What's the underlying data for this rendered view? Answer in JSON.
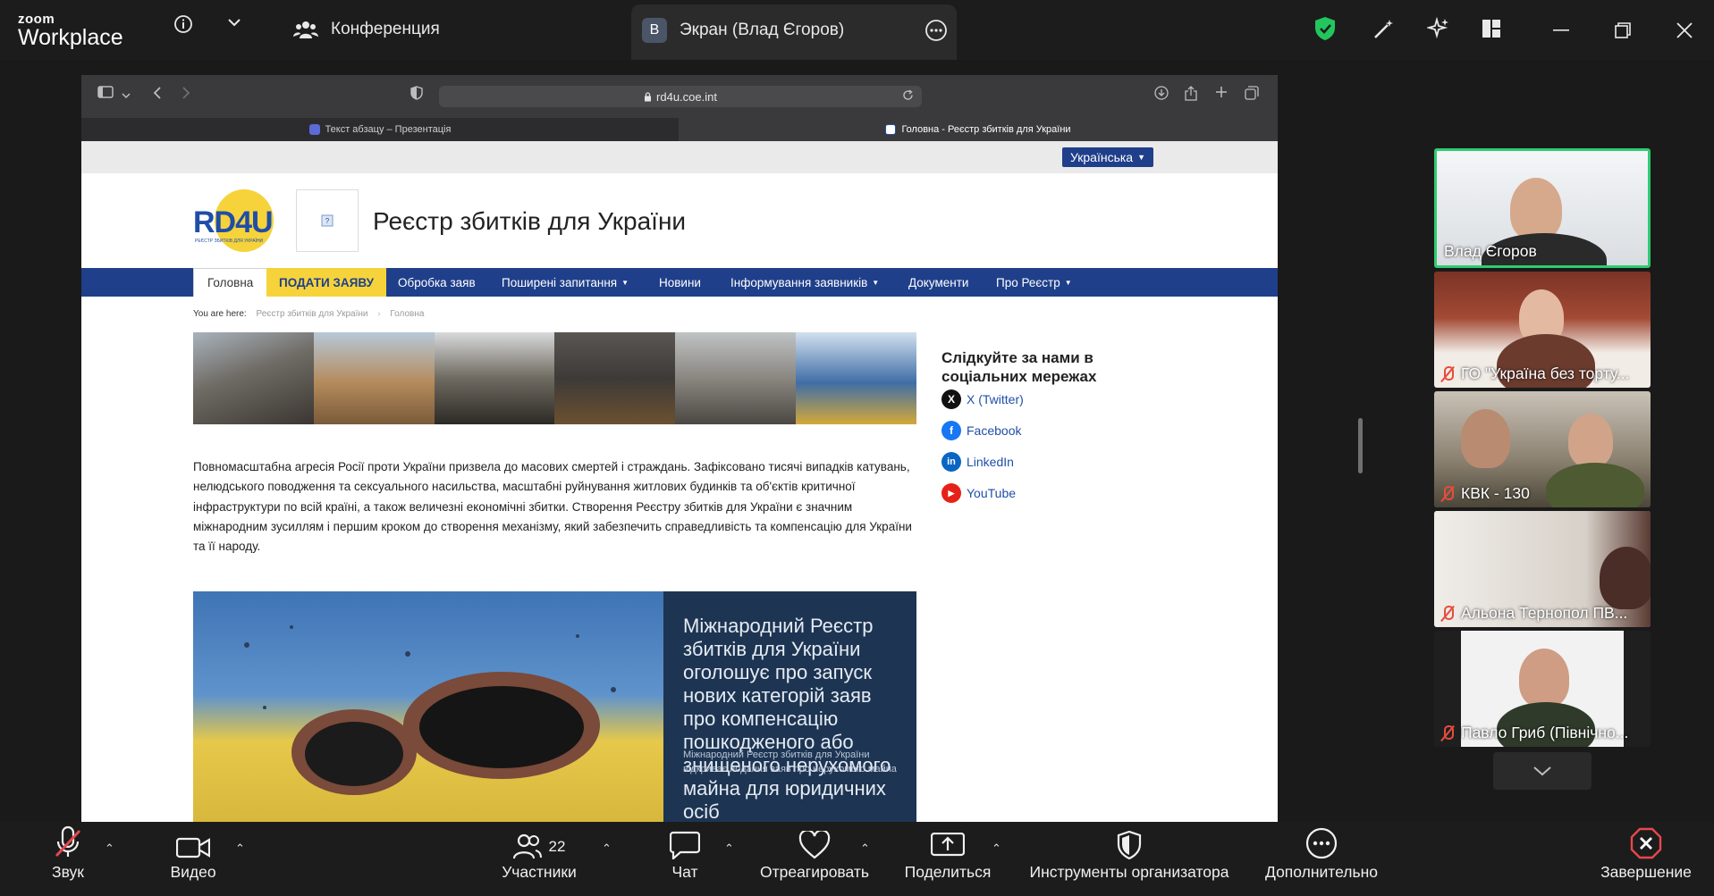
{
  "zoom": {
    "brand_small": "zoom",
    "brand_large": "Workplace",
    "conference_label": "Конференция",
    "screen_badge": "В",
    "screen_label": "Экран (Влад Єгоров)"
  },
  "browser": {
    "url": "rd4u.coe.int",
    "tabs": [
      {
        "title": "Текст абзацу – Презентація"
      },
      {
        "title": "Головна - Реєстр збитків для України"
      }
    ]
  },
  "site": {
    "language": "Українська",
    "logo_text": "RD4U",
    "logo_subtext": "РЕЄСТР ЗБИТКІВ ДЛЯ УКРАЇНИ",
    "title": "Реєстр збитків для України",
    "nav": {
      "home": "Головна",
      "apply": "ПОДАТИ ЗАЯВУ",
      "processing": "Обробка заяв",
      "faq": "Поширені запитання",
      "news": "Новини",
      "inform": "Інформування заявників",
      "docs": "Документи",
      "about": "Про Реєстр"
    },
    "breadcrumb": {
      "prefix": "You are here:",
      "item1": "Реєстр збитків для України",
      "item2": "Головна"
    },
    "paragraph": "Повномасштабна агресія Росії проти України призвела до масових смертей і страждань. Зафіксовано тисячі випадків катувань, нелюдського поводження та сексуального насильства, масштабні руйнування житлових будинків та об'єктів критичної інфраструктури по всій країні, а також величезні економічні збитки. Створення Реєстру збитків для України є значним міжнародним зусиллям і першим кроком до створення механізму, який забезпечить справедливість та компенсацію для України та її народу.",
    "social": {
      "heading": "Слідкуйте за нами в соціальних мережах",
      "x": "X (Twitter)",
      "facebook": "Facebook",
      "linkedin": "LinkedIn",
      "youtube": "YouTube"
    },
    "feature": {
      "headline": "Міжнародний Реєстр збитків для України оголошує про запуск нових категорій заяв про компенсацію пошкодженого або знищеного нерухомого майна для юридичних осіб",
      "overlay": "Міжнародний Реєстр збитків для України відкриває подання заяв про нерухомого майна"
    }
  },
  "participants": [
    {
      "name": "Влад Єгоров",
      "muted": false
    },
    {
      "name": "ГО \"Україна без торту...",
      "muted": true
    },
    {
      "name": "КВК - 130",
      "muted": true
    },
    {
      "name": "Альона Тернопол ПВ...",
      "muted": true
    },
    {
      "name": "Павло Гриб (Північно...",
      "muted": true
    }
  ],
  "toolbar": {
    "audio": "Звук",
    "video": "Видео",
    "participants": "Участники",
    "participants_count": "22",
    "chat": "Чат",
    "react": "Отреагировать",
    "share": "Поделиться",
    "host_tools": "Инструменты организатора",
    "more": "Дополнительно",
    "end": "Завершение"
  },
  "colors": {
    "zoom_bg": "#1c1c1c",
    "site_blue": "#1f3f8a",
    "site_yellow": "#f6d33b",
    "active_speaker": "#2ecc71",
    "end_red": "#e5484d"
  }
}
